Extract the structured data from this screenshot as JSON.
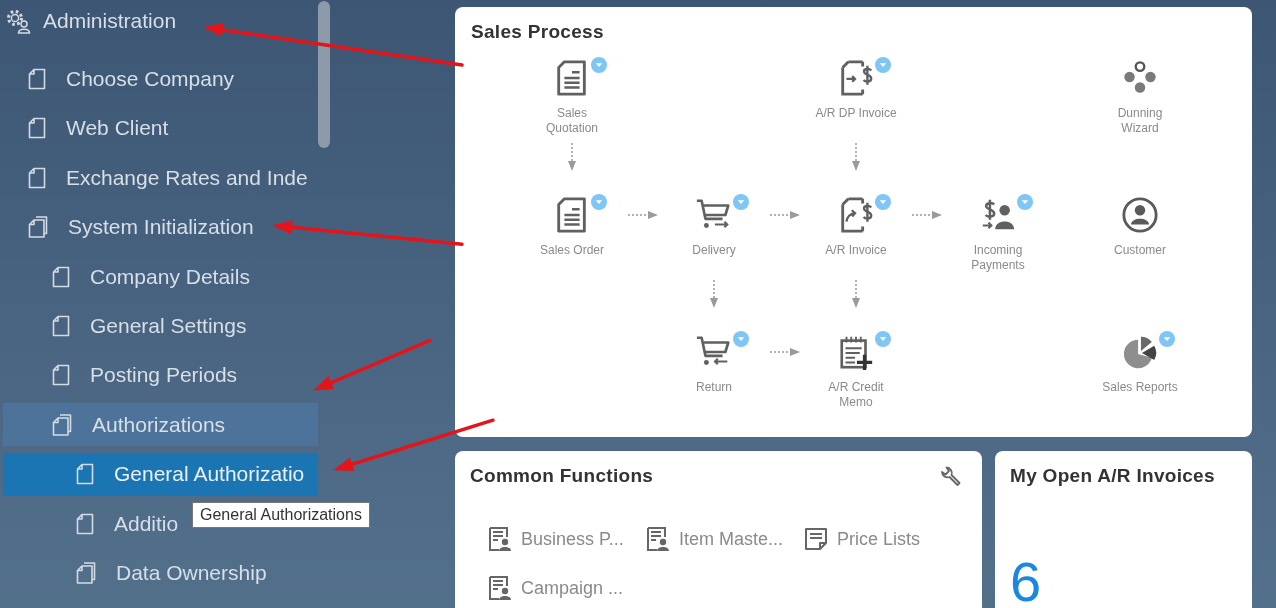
{
  "sidebar": {
    "items": [
      {
        "kind": "module",
        "label": "Administration",
        "selected": false,
        "highlighted": false,
        "annotated": true,
        "children": [
          {
            "kind": "form",
            "label": "Choose Company",
            "selected": false,
            "highlighted": false,
            "annotated": false
          },
          {
            "kind": "form",
            "label": "Web Client",
            "selected": false,
            "highlighted": false,
            "annotated": false
          },
          {
            "kind": "form",
            "label": "Exchange Rates and Inde",
            "selected": false,
            "highlighted": false,
            "annotated": false
          },
          {
            "kind": "folder",
            "label": "System Initialization",
            "selected": false,
            "highlighted": false,
            "annotated": true,
            "children": [
              {
                "kind": "form",
                "label": "Company Details",
                "selected": false,
                "highlighted": false,
                "annotated": false
              },
              {
                "kind": "form",
                "label": "General Settings",
                "selected": false,
                "highlighted": false,
                "annotated": false
              },
              {
                "kind": "form",
                "label": "Posting Periods",
                "selected": false,
                "highlighted": false,
                "annotated": true
              },
              {
                "kind": "folder",
                "label": "Authorizations",
                "selected": false,
                "highlighted": true,
                "annotated": false,
                "children": [
                  {
                    "kind": "form",
                    "label": "General Authorizatio",
                    "selected": true,
                    "highlighted": false,
                    "annotated": true
                  },
                  {
                    "kind": "form",
                    "label": "Additio",
                    "selected": false,
                    "highlighted": false,
                    "annotated": false
                  },
                  {
                    "kind": "folder",
                    "label": "Data Ownership",
                    "selected": false,
                    "highlighted": false,
                    "annotated": false
                  }
                ]
              }
            ]
          }
        ]
      }
    ]
  },
  "tooltip": {
    "text": "General Authorizations"
  },
  "sales_process": {
    "title": "Sales Process",
    "rows": [
      [
        {
          "label": "Sales\nQuotation",
          "dropdown": true,
          "arrow_right": false,
          "arrow_down": true
        },
        null,
        {
          "label": "A/R DP Invoice",
          "dropdown": true,
          "arrow_right": false,
          "arrow_down": true
        },
        null,
        {
          "label": "Dunning\nWizard",
          "dropdown": false,
          "arrow_right": false,
          "arrow_down": false
        }
      ],
      [
        {
          "label": "Sales Order",
          "dropdown": true,
          "arrow_right": true,
          "arrow_down": false
        },
        {
          "label": "Delivery",
          "dropdown": true,
          "arrow_right": true,
          "arrow_down": true
        },
        {
          "label": "A/R Invoice",
          "dropdown": true,
          "arrow_right": true,
          "arrow_down": true
        },
        {
          "label": "Incoming\nPayments",
          "dropdown": true,
          "arrow_right": false,
          "arrow_down": false
        },
        {
          "label": "Customer",
          "dropdown": false,
          "arrow_right": false,
          "arrow_down": false
        }
      ],
      [
        null,
        {
          "label": "Return",
          "dropdown": true,
          "arrow_right": true,
          "arrow_down": false
        },
        {
          "label": "A/R Credit\nMemo",
          "dropdown": true,
          "arrow_right": false,
          "arrow_down": false
        },
        null,
        {
          "label": "Sales Reports",
          "dropdown": true,
          "arrow_right": false,
          "arrow_down": false
        }
      ]
    ]
  },
  "common_functions": {
    "title": "Common Functions",
    "items": [
      "Business P...",
      "Item Maste...",
      "Price Lists",
      "Campaign ..."
    ]
  },
  "open_invoices": {
    "title": "My Open A/R Invoices",
    "count": "6"
  }
}
